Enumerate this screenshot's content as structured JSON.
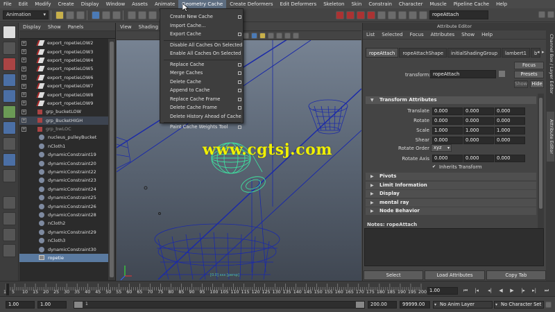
{
  "menubar": [
    "File",
    "Edit",
    "Modify",
    "Create",
    "Display",
    "Window",
    "Assets",
    "Animate",
    "Geometry Cache",
    "Create Deformers",
    "Edit Deformers",
    "Skeleton",
    "Skin",
    "Constrain",
    "Character",
    "Muscle",
    "Pipeline Cache",
    "Help"
  ],
  "status_line": {
    "mode": "Animation",
    "object_field": "ropeAttach"
  },
  "outliner": {
    "menu": [
      "Display",
      "Show",
      "Panels"
    ],
    "items": [
      {
        "label": "export_ropetieLOW2",
        "icon": "curve-icon",
        "expand": "+"
      },
      {
        "label": "export_ropetieLOW3",
        "icon": "curve-icon",
        "expand": "+"
      },
      {
        "label": "export_ropetieLOW4",
        "icon": "curve-icon",
        "expand": "+"
      },
      {
        "label": "export_ropetieLOW5",
        "icon": "curve-icon",
        "expand": "+"
      },
      {
        "label": "export_ropetieLOW6",
        "icon": "curve-icon",
        "expand": "+"
      },
      {
        "label": "export_ropetieLOW7",
        "icon": "curve-icon",
        "expand": "+"
      },
      {
        "label": "export_ropetieLOW8",
        "icon": "curve-icon",
        "expand": "+"
      },
      {
        "label": "export_ropetieLOW9",
        "icon": "curve-icon",
        "expand": "+"
      },
      {
        "label": "grp_bucketLOW",
        "icon": "group-icon",
        "expand": "+"
      },
      {
        "label": "grp_BucketHIGH",
        "icon": "group-icon",
        "expand": "+",
        "state": "hl"
      },
      {
        "label": "grp_bwLOC",
        "icon": "group-icon",
        "expand": "+",
        "state": "dim"
      },
      {
        "label": "nucleus_pulleyBucket",
        "icon": "node-icon",
        "expand": ""
      },
      {
        "label": "nCloth1",
        "icon": "node-icon",
        "expand": ""
      },
      {
        "label": "dynamicConstraint19",
        "icon": "node-icon",
        "expand": ""
      },
      {
        "label": "dynamicConstraint20",
        "icon": "node-icon",
        "expand": ""
      },
      {
        "label": "dynamicConstraint22",
        "icon": "node-icon",
        "expand": ""
      },
      {
        "label": "dynamicConstraint23",
        "icon": "node-icon",
        "expand": ""
      },
      {
        "label": "dynamicConstraint24",
        "icon": "node-icon",
        "expand": ""
      },
      {
        "label": "dynamicConstraint25",
        "icon": "node-icon",
        "expand": ""
      },
      {
        "label": "dynamicConstraint26",
        "icon": "node-icon",
        "expand": ""
      },
      {
        "label": "dynamicConstraint28",
        "icon": "node-icon",
        "expand": ""
      },
      {
        "label": "nCloth2",
        "icon": "node-icon",
        "expand": ""
      },
      {
        "label": "dynamicConstraint29",
        "icon": "node-icon",
        "expand": ""
      },
      {
        "label": "nCloth3",
        "icon": "node-icon",
        "expand": ""
      },
      {
        "label": "dynamicConstraint30",
        "icon": "node-icon",
        "expand": ""
      },
      {
        "label": "ropetie",
        "icon": "mesh-icon",
        "expand": "",
        "state": "sel"
      }
    ]
  },
  "viewport": {
    "menu": [
      "View",
      "Shading"
    ],
    "camera_label": "[0.0] xxx [persp]"
  },
  "geometry_cache_menu": [
    {
      "label": "Create New Cache",
      "box": true
    },
    {
      "label": "Import Cache...",
      "box": false
    },
    {
      "label": "Export Cache",
      "box": true
    },
    {
      "sep": true
    },
    {
      "label": "Disable All Caches On Selected",
      "box": false
    },
    {
      "label": "Enable All Caches On Selected",
      "box": false
    },
    {
      "sep": true
    },
    {
      "label": "Replace Cache",
      "box": true
    },
    {
      "label": "Merge Caches",
      "box": true
    },
    {
      "label": "Delete Cache",
      "box": true
    },
    {
      "label": "Append to Cache",
      "box": true
    },
    {
      "label": "Replace Cache Frame",
      "box": true
    },
    {
      "label": "Delete Cache Frame",
      "box": true
    },
    {
      "label": "Delete History Ahead of Cache",
      "box": false
    },
    {
      "sep": true
    },
    {
      "label": "Paint Cache Weights Tool",
      "box": true
    }
  ],
  "watermark": "www.cgtsj.com",
  "attribute_editor": {
    "title": "Attribute Editor",
    "menu": [
      "List",
      "Selected",
      "Focus",
      "Attributes",
      "Show",
      "Help"
    ],
    "tabs": [
      "ropeAttach",
      "ropeAttachShape",
      "initialShadingGroup",
      "lambert1",
      "b"
    ],
    "transform_label": "transform:",
    "transform_value": "ropeAttach",
    "buttons": {
      "focus": "Focus",
      "presets": "Presets",
      "show": "Show",
      "hide": "Hide"
    },
    "section_title": "Transform Attributes",
    "attrs": [
      {
        "label": "Translate",
        "values": [
          "0.000",
          "0.000",
          "0.000"
        ]
      },
      {
        "label": "Rotate",
        "values": [
          "0.000",
          "0.000",
          "0.000"
        ]
      },
      {
        "label": "Scale",
        "values": [
          "1.000",
          "1.000",
          "1.000"
        ]
      },
      {
        "label": "Shear",
        "values": [
          "0.000",
          "0.000",
          "0.000"
        ]
      }
    ],
    "rotate_order_label": "Rotate Order",
    "rotate_order": "xyz",
    "rotate_axis_label": "Rotate Axis",
    "rotate_axis": [
      "0.000",
      "0.000",
      "0.000"
    ],
    "inherits_transform": "Inherits Transform",
    "sections": [
      "Pivots",
      "Limit Information",
      "Display",
      "mental ray",
      "Node Behavior"
    ],
    "notes_label": "Notes:  ropeAttach",
    "bottom_buttons": [
      "Select",
      "Load Attributes",
      "Copy Tab"
    ]
  },
  "side_tabs": [
    "Channel Box / Layer Editor",
    "Attribute Editor"
  ],
  "timeslider": {
    "ticks": [
      "1",
      "5",
      "10",
      "15",
      "20",
      "25",
      "30",
      "35",
      "40",
      "45",
      "50",
      "55",
      "60",
      "65",
      "70",
      "75",
      "80",
      "85",
      "90",
      "95",
      "100",
      "105",
      "110",
      "115",
      "120",
      "125",
      "130",
      "135",
      "140",
      "145",
      "150",
      "155",
      "160",
      "165",
      "170",
      "175",
      "180",
      "185",
      "190",
      "195",
      "200"
    ],
    "current_frame": "1.00"
  },
  "range": {
    "start": "1.00",
    "playback_start": "1.00",
    "range_value": "1",
    "playback_end": "200.00",
    "end": "99999.00",
    "anim_layer": "No Anim Layer",
    "character_set": "No Character Set"
  }
}
